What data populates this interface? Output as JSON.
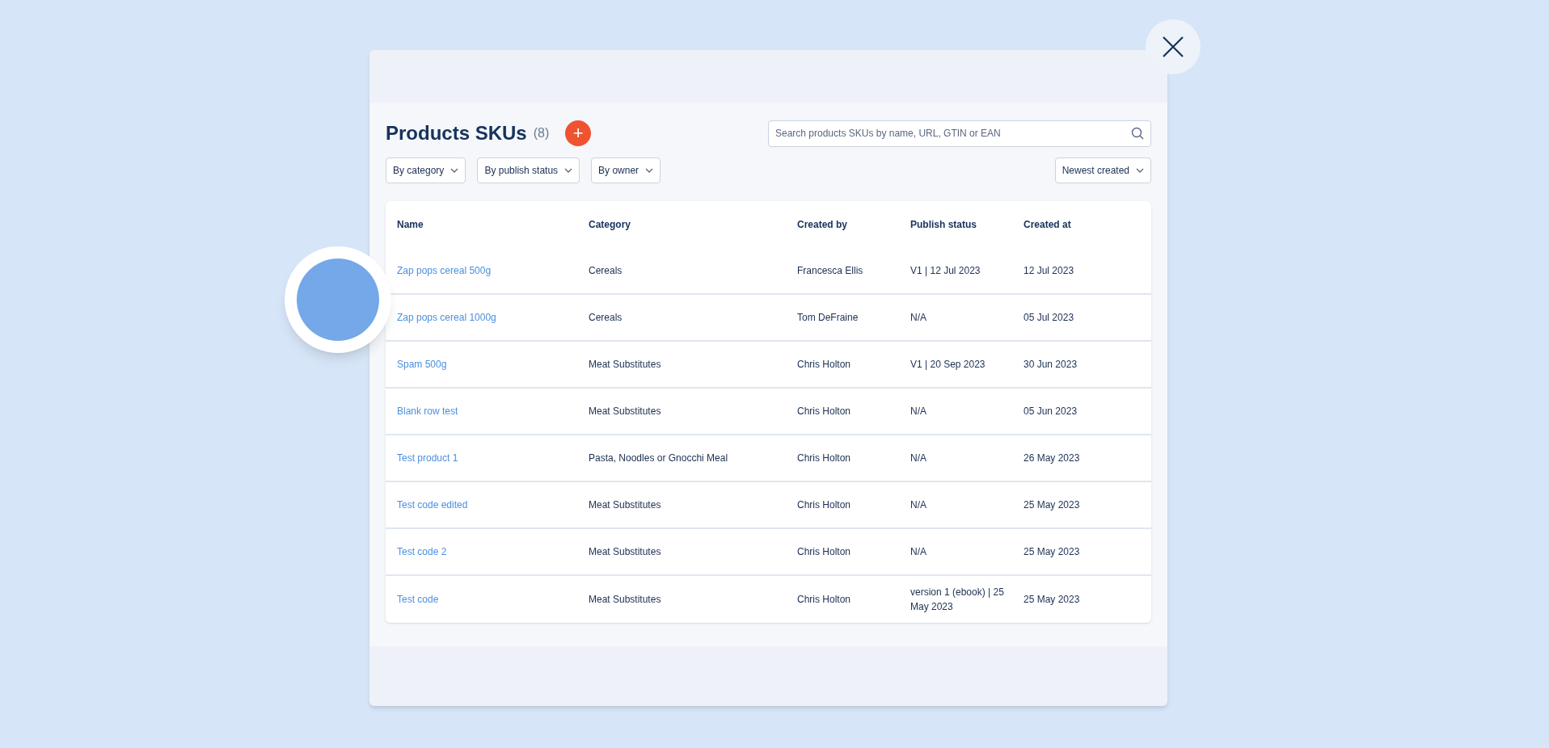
{
  "title": "Products SKUs",
  "count": "(8)",
  "add_button": "+",
  "search": {
    "placeholder": "Search products SKUs by name, URL, GTIN or EAN"
  },
  "filters": [
    "By category",
    "By publish status",
    "By owner"
  ],
  "sort": "Newest created",
  "table": {
    "columns": [
      "Name",
      "Category",
      "Created by",
      "Publish status",
      "Created at"
    ],
    "rows": [
      [
        "Zap pops cereal 500g",
        "Cereals",
        "Francesca Ellis",
        "V1 | 12 Jul 2023",
        "12 Jul 2023"
      ],
      [
        "Zap pops cereal 1000g",
        "Cereals",
        "Tom DeFraine",
        "N/A",
        "05 Jul 2023"
      ],
      [
        "Spam 500g",
        "Meat Substitutes",
        "Chris Holton",
        "V1 | 20 Sep 2023",
        "30 Jun 2023"
      ],
      [
        "Blank row test",
        "Meat Substitutes",
        "Chris Holton",
        "N/A",
        "05 Jun 2023"
      ],
      [
        "Test product 1",
        "Pasta, Noodles or Gnocchi Meal",
        "Chris Holton",
        "N/A",
        "26 May 2023"
      ],
      [
        "Test code edited",
        "Meat Substitutes",
        "Chris Holton",
        "N/A",
        "25 May 2023"
      ],
      [
        "Test code 2",
        "Meat Substitutes",
        "Chris Holton",
        "N/A",
        "25 May 2023"
      ],
      [
        "Test code",
        "Meat Substitutes",
        "Chris Holton",
        "version 1 (ebook) | 25 May 2023",
        "25 May 2023"
      ]
    ]
  }
}
